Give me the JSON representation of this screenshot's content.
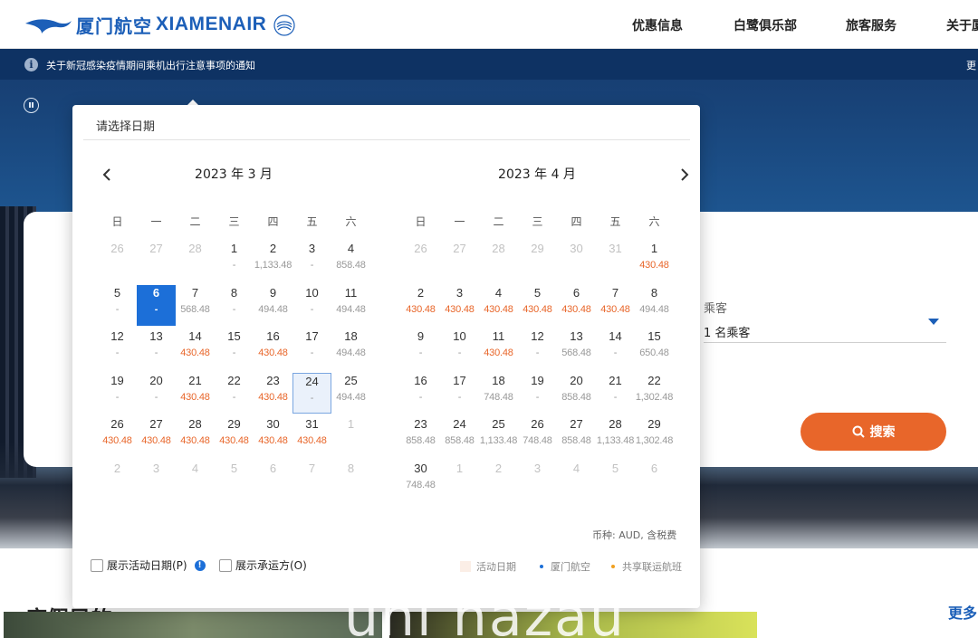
{
  "header": {
    "logo_cn": "厦门航空",
    "logo_en": "XIAMENAIR",
    "nav": [
      "优惠信息",
      "白鹭俱乐部",
      "旅客服务",
      "关于厦"
    ]
  },
  "notice": {
    "text": "关于新冠感染疫情期间乘机出行注意事项的通知",
    "more": "更"
  },
  "booking": {
    "passenger_label": "乘客",
    "passenger_value": "1 名乘客",
    "search_button": "搜索"
  },
  "picker": {
    "title": "请选择日期",
    "weekdays": [
      "日",
      "一",
      "二",
      "三",
      "四",
      "五",
      "六"
    ],
    "months": [
      {
        "title": "2023 年 3 月",
        "days": [
          {
            "d": "26",
            "p": "",
            "t": "other"
          },
          {
            "d": "27",
            "p": "",
            "t": "other"
          },
          {
            "d": "28",
            "p": "",
            "t": "other"
          },
          {
            "d": "1",
            "p": "-",
            "t": ""
          },
          {
            "d": "2",
            "p": "1,133.48",
            "t": ""
          },
          {
            "d": "3",
            "p": "-",
            "t": ""
          },
          {
            "d": "4",
            "p": "858.48",
            "t": ""
          },
          {
            "d": "5",
            "p": "-",
            "t": ""
          },
          {
            "d": "6",
            "p": "-",
            "t": "sel"
          },
          {
            "d": "7",
            "p": "568.48",
            "t": ""
          },
          {
            "d": "8",
            "p": "-",
            "t": ""
          },
          {
            "d": "9",
            "p": "494.48",
            "t": ""
          },
          {
            "d": "10",
            "p": "-",
            "t": ""
          },
          {
            "d": "11",
            "p": "494.48",
            "t": ""
          },
          {
            "d": "12",
            "p": "-",
            "t": ""
          },
          {
            "d": "13",
            "p": "-",
            "t": ""
          },
          {
            "d": "14",
            "p": "430.48",
            "t": "hl"
          },
          {
            "d": "15",
            "p": "-",
            "t": ""
          },
          {
            "d": "16",
            "p": "430.48",
            "t": "hl"
          },
          {
            "d": "17",
            "p": "-",
            "t": ""
          },
          {
            "d": "18",
            "p": "494.48",
            "t": ""
          },
          {
            "d": "19",
            "p": "-",
            "t": ""
          },
          {
            "d": "20",
            "p": "-",
            "t": ""
          },
          {
            "d": "21",
            "p": "430.48",
            "t": "hl"
          },
          {
            "d": "22",
            "p": "-",
            "t": ""
          },
          {
            "d": "23",
            "p": "430.48",
            "t": "hl"
          },
          {
            "d": "24",
            "p": "-",
            "t": "ret"
          },
          {
            "d": "25",
            "p": "494.48",
            "t": ""
          },
          {
            "d": "26",
            "p": "430.48",
            "t": "hl"
          },
          {
            "d": "27",
            "p": "430.48",
            "t": "hl"
          },
          {
            "d": "28",
            "p": "430.48",
            "t": "hl"
          },
          {
            "d": "29",
            "p": "430.48",
            "t": "hl"
          },
          {
            "d": "30",
            "p": "430.48",
            "t": "hl"
          },
          {
            "d": "31",
            "p": "430.48",
            "t": "hl"
          },
          {
            "d": "1",
            "p": "",
            "t": "other"
          },
          {
            "d": "2",
            "p": "",
            "t": "other"
          },
          {
            "d": "3",
            "p": "",
            "t": "other"
          },
          {
            "d": "4",
            "p": "",
            "t": "other"
          },
          {
            "d": "5",
            "p": "",
            "t": "other"
          },
          {
            "d": "6",
            "p": "",
            "t": "other"
          },
          {
            "d": "7",
            "p": "",
            "t": "other"
          },
          {
            "d": "8",
            "p": "",
            "t": "other"
          }
        ]
      },
      {
        "title": "2023 年 4 月",
        "days": [
          {
            "d": "26",
            "p": "",
            "t": "other"
          },
          {
            "d": "27",
            "p": "",
            "t": "other"
          },
          {
            "d": "28",
            "p": "",
            "t": "other"
          },
          {
            "d": "29",
            "p": "",
            "t": "other"
          },
          {
            "d": "30",
            "p": "",
            "t": "other"
          },
          {
            "d": "31",
            "p": "",
            "t": "other"
          },
          {
            "d": "1",
            "p": "430.48",
            "t": "hl"
          },
          {
            "d": "2",
            "p": "430.48",
            "t": "hl"
          },
          {
            "d": "3",
            "p": "430.48",
            "t": "hl"
          },
          {
            "d": "4",
            "p": "430.48",
            "t": "hl"
          },
          {
            "d": "5",
            "p": "430.48",
            "t": "hl"
          },
          {
            "d": "6",
            "p": "430.48",
            "t": "hl"
          },
          {
            "d": "7",
            "p": "430.48",
            "t": "hl"
          },
          {
            "d": "8",
            "p": "494.48",
            "t": ""
          },
          {
            "d": "9",
            "p": "-",
            "t": ""
          },
          {
            "d": "10",
            "p": "-",
            "t": ""
          },
          {
            "d": "11",
            "p": "430.48",
            "t": "hl"
          },
          {
            "d": "12",
            "p": "-",
            "t": ""
          },
          {
            "d": "13",
            "p": "568.48",
            "t": ""
          },
          {
            "d": "14",
            "p": "-",
            "t": ""
          },
          {
            "d": "15",
            "p": "650.48",
            "t": ""
          },
          {
            "d": "16",
            "p": "-",
            "t": ""
          },
          {
            "d": "17",
            "p": "-",
            "t": ""
          },
          {
            "d": "18",
            "p": "748.48",
            "t": ""
          },
          {
            "d": "19",
            "p": "-",
            "t": ""
          },
          {
            "d": "20",
            "p": "858.48",
            "t": ""
          },
          {
            "d": "21",
            "p": "-",
            "t": ""
          },
          {
            "d": "22",
            "p": "1,302.48",
            "t": ""
          },
          {
            "d": "23",
            "p": "858.48",
            "t": ""
          },
          {
            "d": "24",
            "p": "858.48",
            "t": ""
          },
          {
            "d": "25",
            "p": "1,133.48",
            "t": ""
          },
          {
            "d": "26",
            "p": "748.48",
            "t": ""
          },
          {
            "d": "27",
            "p": "858.48",
            "t": ""
          },
          {
            "d": "28",
            "p": "1,133.48",
            "t": ""
          },
          {
            "d": "29",
            "p": "1,302.48",
            "t": ""
          },
          {
            "d": "30",
            "p": "748.48",
            "t": ""
          },
          {
            "d": "1",
            "p": "",
            "t": "other"
          },
          {
            "d": "2",
            "p": "",
            "t": "other"
          },
          {
            "d": "3",
            "p": "",
            "t": "other"
          },
          {
            "d": "4",
            "p": "",
            "t": "other"
          },
          {
            "d": "5",
            "p": "",
            "t": "other"
          },
          {
            "d": "6",
            "p": "",
            "t": "other"
          }
        ]
      }
    ],
    "currency_note": "币种: AUD, 含税费",
    "checkbox_activity": "展示活动日期(P)",
    "checkbox_carrier": "展示承运方(O)",
    "legend_activity": "活动日期",
    "legend_xiamen": "厦门航空",
    "legend_codeshare": "共享联运航班"
  },
  "below": {
    "promo_title": "度假目的",
    "more": "更多"
  },
  "watermark": "uni nazau",
  "colors": {
    "brand_blue": "#1c5fb8",
    "selected": "#1c6fd8",
    "price_highlight": "#e8662a",
    "search_button": "#e8662a",
    "notice_bar": "#0e3263",
    "legend_xiamen_dot": "#1c6fd8",
    "legend_codeshare_dot": "#f0a020"
  }
}
